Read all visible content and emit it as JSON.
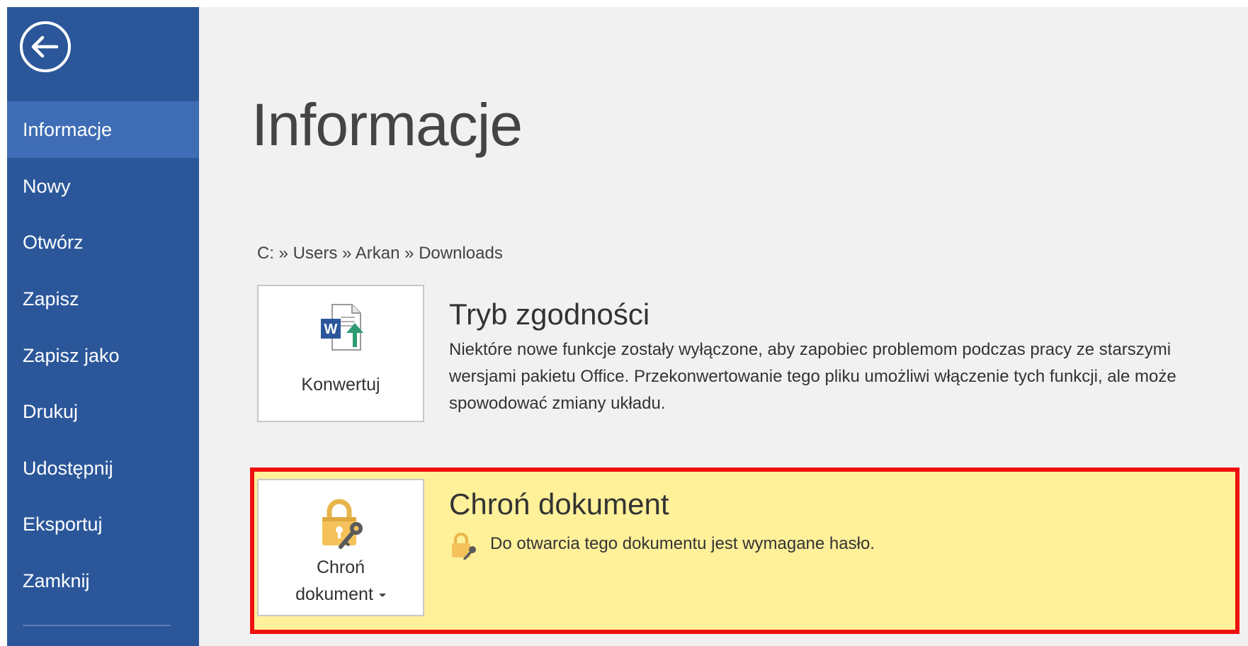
{
  "sidebar": {
    "back_icon": "back-arrow-circle-icon",
    "items": [
      {
        "label": "Informacje",
        "active": true
      },
      {
        "label": "Nowy"
      },
      {
        "label": "Otwórz"
      },
      {
        "label": "Zapisz"
      },
      {
        "label": "Zapisz jako"
      },
      {
        "label": "Drukuj"
      },
      {
        "label": "Udostępnij"
      },
      {
        "label": "Eksportuj"
      },
      {
        "label": "Zamknij"
      }
    ]
  },
  "main": {
    "title": "Informacje",
    "breadcrumb": "C: » Users » Arkan » Downloads",
    "compatibility": {
      "button_label": "Konwertuj",
      "button_icon": "word-document-convert-icon",
      "title": "Tryb zgodności",
      "description": "Niektóre nowe funkcje zostały wyłączone, aby zapobiec problemom podczas pracy ze starszymi wersjami pakietu Office. Przekonwertowanie tego pliku umożliwi włączenie tych funkcji, ale może spowodować zmiany układu."
    },
    "protect": {
      "button_label_line1": "Chroń",
      "button_label_line2": "dokument",
      "button_icon": "lock-key-icon",
      "title": "Chroń dokument",
      "info_icon": "lock-key-small-icon",
      "info_text": "Do otwarcia tego dokumentu jest wymagane hasło."
    }
  },
  "colors": {
    "sidebar_bg": "#2b579a",
    "sidebar_active": "#3e6db5",
    "content_bg": "#f1f1f1",
    "highlight_bg": "#fff09a",
    "highlight_border": "#ef1010"
  }
}
